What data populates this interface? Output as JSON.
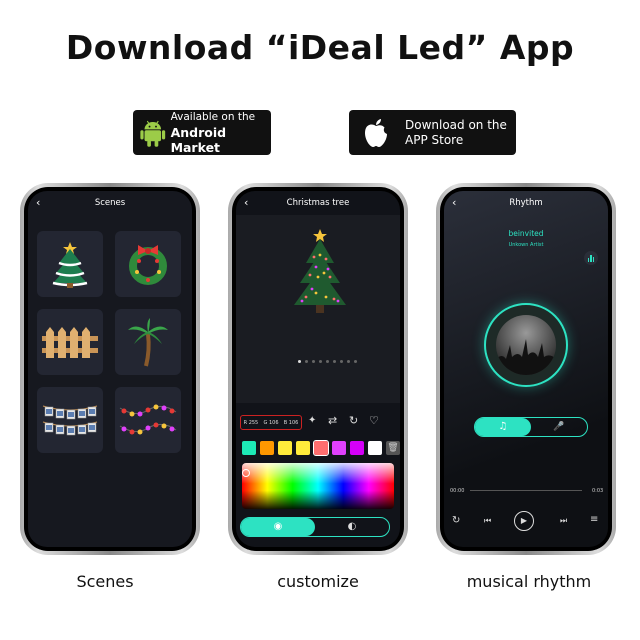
{
  "header": {
    "title": "Download “iDeal Led” App"
  },
  "badges": {
    "android": {
      "line1": "Available on the",
      "line2": "Android Market"
    },
    "apple": {
      "line1": "Download on the",
      "line2": "APP Store"
    }
  },
  "phones": {
    "scenes": {
      "title": "Scenes",
      "caption": "Scenes",
      "tiles": [
        "christmas-tree",
        "wreath",
        "fence",
        "palm-tree",
        "photo-string",
        "light-string"
      ]
    },
    "customize": {
      "title": "Christmas tree",
      "caption": "customize",
      "rgb": {
        "r": "R 255",
        "g": "G 106",
        "b": "B 106"
      },
      "swatches": [
        "#1de9b6",
        "#ff9800",
        "#ffeb3b",
        "#ffeb3b",
        "#ff6e6e",
        "#e040fb",
        "#d500f9",
        "#ffffff"
      ]
    },
    "rhythm": {
      "title": "Rhythm",
      "caption": "musical rhythm",
      "song": "beinvited",
      "artist": "Unkown Artist",
      "time_start": "00:00",
      "time_end": "0:03"
    }
  },
  "colors": {
    "accent": "#2de2c2",
    "bg_dark": "#14161d"
  }
}
